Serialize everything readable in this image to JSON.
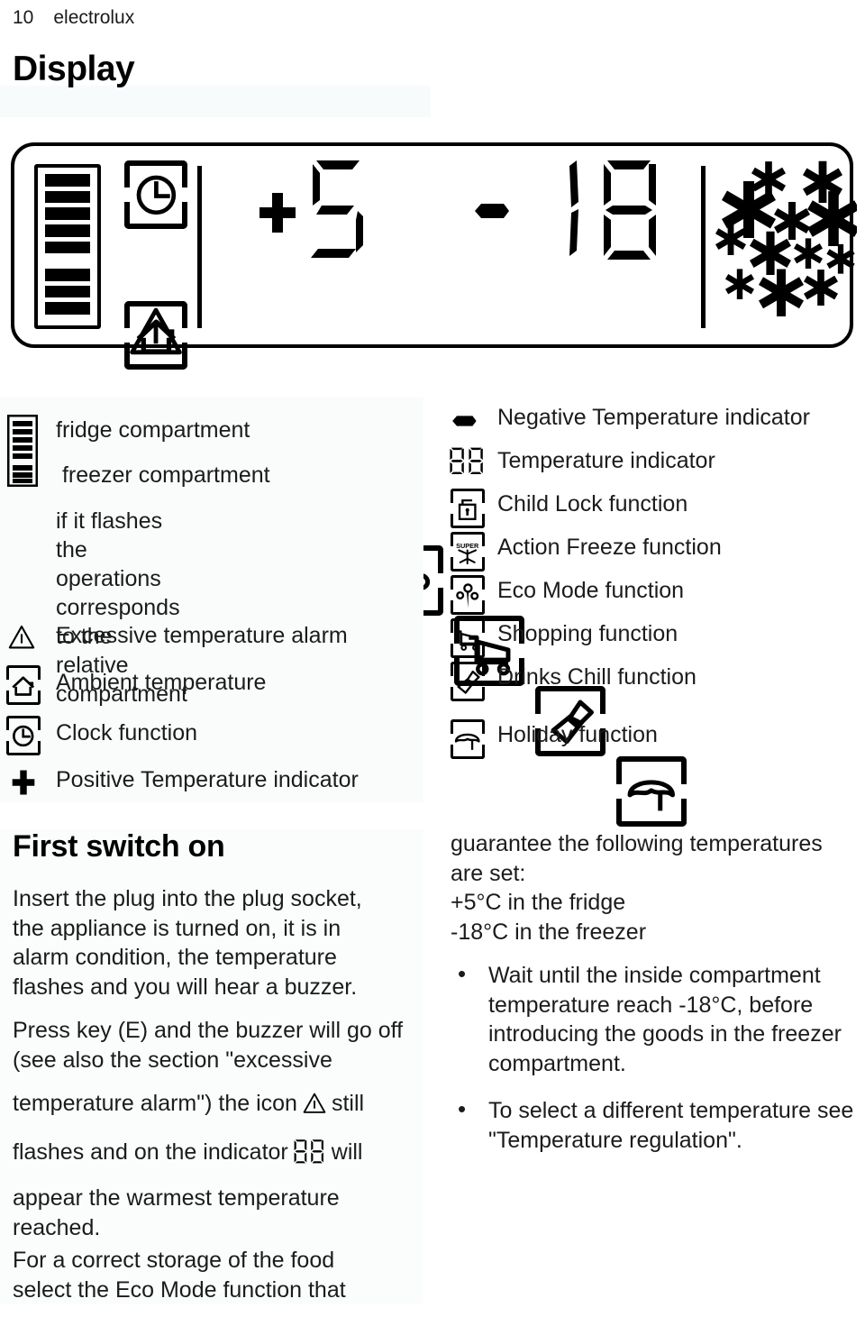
{
  "header": {
    "page_number": "10",
    "brand": "electrolux"
  },
  "section": {
    "title": "Display"
  },
  "display_panel": {
    "fridge_temperature": "+5",
    "fridge_sign": "+",
    "fridge_digits": "5",
    "freezer_sign": "-",
    "freezer_digits": "18",
    "freezer_temperature": "-18",
    "super_label": "SUPER",
    "icons": [
      "bar-level-indicator-icon",
      "clock-icon",
      "house-ambient-icon",
      "warning-triangle-icon",
      "action-freeze-super-icon",
      "child-lock-icon",
      "eco-mode-icon",
      "shopping-cart-icon",
      "bottle-chill-icon",
      "umbrella-holiday-icon",
      "snowflake-cluster-icon"
    ]
  },
  "legend": {
    "left": [
      {
        "icon": "bar-level-indicator-icon",
        "label": "fridge compartment"
      },
      {
        "icon": "",
        "label": " freezer compartment"
      },
      {
        "icon": "",
        "label": "if it flashes the operations\ncorresponds to the relative\ncompartment"
      },
      {
        "icon": "warning-triangle-icon",
        "label": "Excessive temperature alarm"
      },
      {
        "icon": "house-ambient-icon",
        "label": "Ambient temperature"
      },
      {
        "icon": "clock-icon",
        "label": "Clock function"
      },
      {
        "icon": "plus-sign-icon",
        "label": "Positive Temperature indicator"
      }
    ],
    "right": [
      {
        "icon": "minus-sign-icon",
        "label": "Negative Temperature indicator"
      },
      {
        "icon": "seven-segment-88-icon",
        "label": "Temperature indicator"
      },
      {
        "icon": "child-lock-icon",
        "label": "Child Lock function"
      },
      {
        "icon": "action-freeze-super-icon",
        "label": "Action Freeze function"
      },
      {
        "icon": "eco-mode-icon",
        "label": "Eco Mode function"
      },
      {
        "icon": "shopping-cart-icon",
        "label": "Shopping function"
      },
      {
        "icon": "bottle-chill-icon",
        "label": "Drinks Chill function"
      },
      {
        "icon": "umbrella-holiday-icon",
        "label": "Holiday function"
      }
    ]
  },
  "body": {
    "heading": "First switch on",
    "paragraph_1": "Insert  the plug into the plug socket,\nthe appliance is turned on, it is in\nalarm condition, the temperature\nflashes and you will hear a buzzer.",
    "paragraph_2_part_1": "Press key (E) and the buzzer will go off\n(see also the section \"excessive",
    "paragraph_2_part_2": "temperature alarm\") the icon",
    "paragraph_2_part_3": "still",
    "paragraph_2_part_4": "flashes and on the indicator",
    "paragraph_2_part_5": "will",
    "paragraph_2_part_6": "appear the warmest temperature\nreached.",
    "paragraph_3": "For a correct storage of the food\nselect the Eco Mode function that",
    "right_paragraph_1": "guarantee the following temperatures\nare set:\n+5°C in the fridge\n-18°C in the freezer",
    "bullets": [
      "Wait until the inside compartment temperature reach -18°C, before introducing the goods in the freezer compartment.",
      "To select a different temperature see \"Temperature regulation\"."
    ]
  },
  "colors": {
    "ink": "#111111",
    "paper": "#ffffff",
    "tint": "#f7fbfb"
  }
}
